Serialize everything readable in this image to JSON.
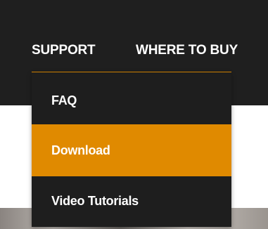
{
  "nav": {
    "items": [
      {
        "label": "SUPPORT"
      },
      {
        "label": "WHERE TO BUY"
      }
    ]
  },
  "dropdown": {
    "items": [
      {
        "label": "FAQ"
      },
      {
        "label": "Download",
        "highlighted": true
      },
      {
        "label": "Video Tutorials"
      }
    ]
  },
  "colors": {
    "nav_background": "#1f1f1f",
    "dropdown_background": "#1e1e1e",
    "accent": "#e08a00",
    "text": "#ffffff"
  }
}
